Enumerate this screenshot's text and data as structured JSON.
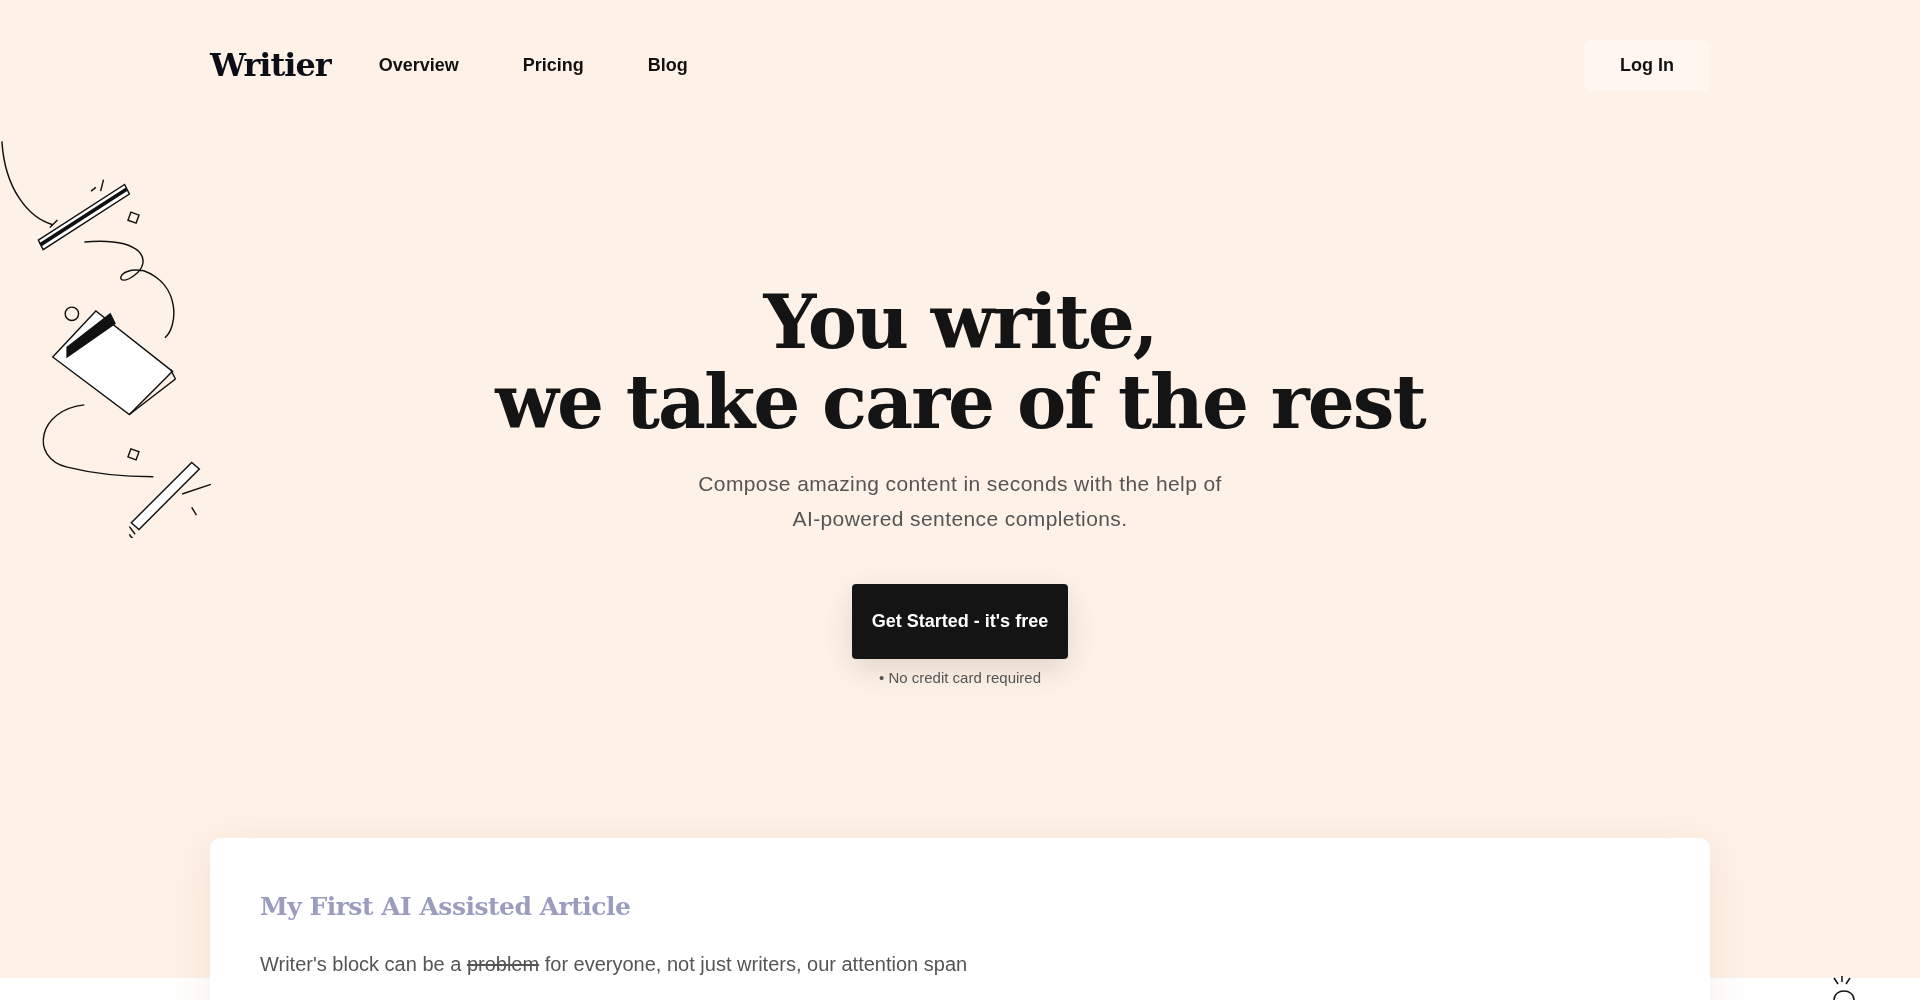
{
  "navbar": {
    "logo": "Writier",
    "links": [
      {
        "label": "Overview"
      },
      {
        "label": "Pricing"
      },
      {
        "label": "Blog"
      }
    ],
    "login": "Log In"
  },
  "hero": {
    "headline_lines": [
      "You write,",
      "we take care of the rest"
    ],
    "subtitle_lines": [
      "Compose amazing content in seconds with the help of",
      "AI-powered sentence completions."
    ],
    "cta": "Get Started - it's free",
    "note": "• No credit card required"
  },
  "article": {
    "title": "My First AI Assisted Article",
    "paragraph": [
      {
        "text": "Writer's block can be a ",
        "struck": false
      },
      {
        "text": "problem",
        "struck": true
      },
      {
        "text": " for everyone, not just writers, our attention span",
        "struck": false
      }
    ]
  }
}
